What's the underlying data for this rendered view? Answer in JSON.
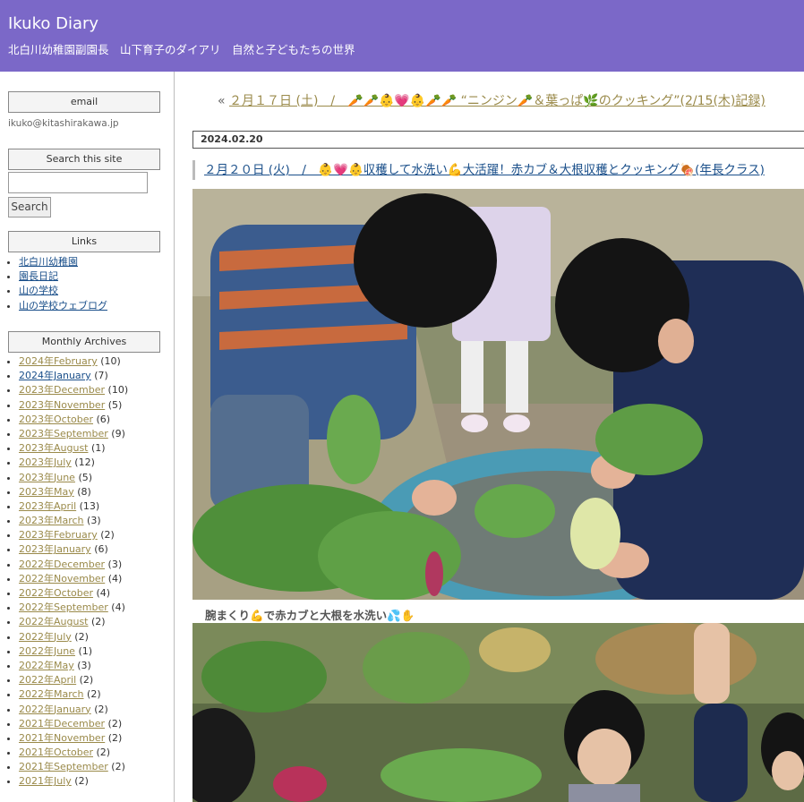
{
  "header": {
    "title": "Ikuko Diary",
    "description": "北白川幼稚園副園長　山下育子のダイアリ　自然と子どもたちの世界"
  },
  "sidebar": {
    "email": {
      "heading": "email",
      "address": "ikuko@kitashirakawa.jp"
    },
    "search": {
      "heading": "Search this site",
      "button_label": "Search",
      "value": ""
    },
    "links": {
      "heading": "Links",
      "items": [
        "北白川幼稚園",
        "園長日記",
        "山の学校",
        "山の学校ウェブログ"
      ]
    },
    "archives": {
      "heading": "Monthly Archives",
      "items": [
        {
          "label": "2024年February",
          "count": "(10)"
        },
        {
          "label": "2024年January",
          "count": "(7)"
        },
        {
          "label": "2023年December",
          "count": "(10)"
        },
        {
          "label": "2023年November",
          "count": "(5)"
        },
        {
          "label": "2023年October",
          "count": "(6)"
        },
        {
          "label": "2023年September",
          "count": "(9)"
        },
        {
          "label": "2023年August",
          "count": "(1)"
        },
        {
          "label": "2023年July",
          "count": "(12)"
        },
        {
          "label": "2023年June",
          "count": "(5)"
        },
        {
          "label": "2023年May",
          "count": "(8)"
        },
        {
          "label": "2023年April",
          "count": "(13)"
        },
        {
          "label": "2023年March",
          "count": "(3)"
        },
        {
          "label": "2023年February",
          "count": "(2)"
        },
        {
          "label": "2023年January",
          "count": "(6)"
        },
        {
          "label": "2022年December",
          "count": "(3)"
        },
        {
          "label": "2022年November",
          "count": "(4)"
        },
        {
          "label": "2022年October",
          "count": "(4)"
        },
        {
          "label": "2022年September",
          "count": "(4)"
        },
        {
          "label": "2022年August",
          "count": "(2)"
        },
        {
          "label": "2022年July",
          "count": "(2)"
        },
        {
          "label": "2022年June",
          "count": "(1)"
        },
        {
          "label": "2022年May",
          "count": "(3)"
        },
        {
          "label": "2022年April",
          "count": "(2)"
        },
        {
          "label": "2022年March",
          "count": "(2)"
        },
        {
          "label": "2022年January",
          "count": "(2)"
        },
        {
          "label": "2021年December",
          "count": "(2)"
        },
        {
          "label": "2021年November",
          "count": "(2)"
        },
        {
          "label": "2021年October",
          "count": "(2)"
        },
        {
          "label": "2021年September",
          "count": "(2)"
        },
        {
          "label": "2021年July",
          "count": "(2)"
        }
      ]
    }
  },
  "main": {
    "prev_nav": {
      "arrow": "«",
      "text": "２月１７日 (土)　/　🥕🥕👶💗👶🥕🥕 “ニンジン🥕＆葉っぱ🌿のクッキング”(2/15(木)記録)"
    },
    "date": "2024.02.20",
    "entry_title": "２月２０日 (火)　/　👶💗👶収穫して水洗い💪大活躍！赤カブ＆大根収穫とクッキング🍖(年長クラス)",
    "caption": "腕まくり💪で赤カブと大根を水洗い💦✋"
  },
  "colors": {
    "header_bg": "#7b68c8",
    "link": "#1a4f8a",
    "visited_link": "#9a8a4a"
  }
}
